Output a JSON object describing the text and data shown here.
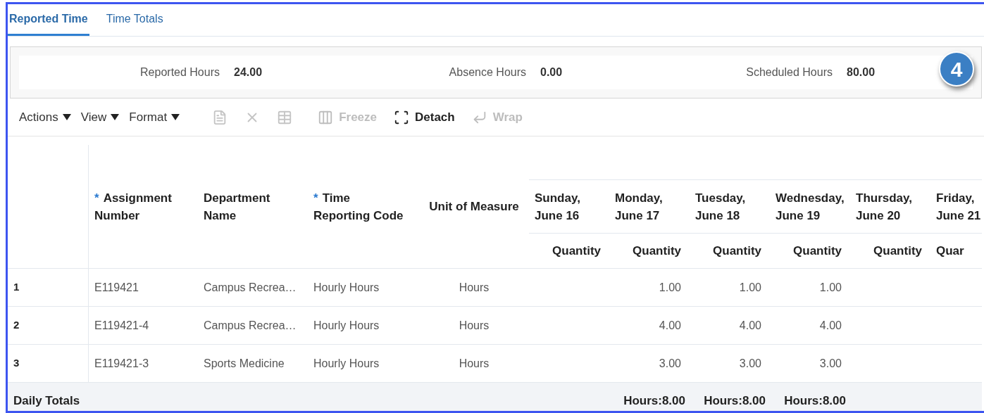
{
  "tabs": [
    {
      "label": "Reported Time",
      "selected": true
    },
    {
      "label": "Time Totals",
      "selected": false
    }
  ],
  "summary": [
    {
      "label": "Reported Hours",
      "value": "24.00"
    },
    {
      "label": "Absence Hours",
      "value": "0.00"
    },
    {
      "label": "Scheduled Hours",
      "value": "80.00"
    }
  ],
  "callout": "4",
  "toolbar": {
    "menus": [
      "Actions",
      "View",
      "Format"
    ],
    "icon_buttons": [
      {
        "kind": "document",
        "disabled": true
      },
      {
        "kind": "delete",
        "disabled": true
      },
      {
        "kind": "grid",
        "disabled": true
      }
    ],
    "buttons": [
      {
        "kind": "freeze",
        "label": "Freeze",
        "disabled": true
      },
      {
        "kind": "detach",
        "label": "Detach",
        "disabled": false
      },
      {
        "kind": "wrap",
        "label": "Wrap",
        "disabled": true
      }
    ]
  },
  "table": {
    "columns": [
      {
        "label": [
          "Assignment",
          "Number"
        ],
        "required_mark": "*"
      },
      {
        "label": [
          "Department",
          "Name"
        ]
      },
      {
        "label": [
          "Time",
          "Reporting Code"
        ],
        "required_mark": "*"
      },
      {
        "label": [
          "Unit of Measure"
        ]
      }
    ],
    "days": [
      {
        "label": [
          "Sunday,",
          "June 16"
        ],
        "sub": "Quantity"
      },
      {
        "label": [
          "Monday,",
          "June 17"
        ],
        "sub": "Quantity",
        "quantities": [
          "1.00",
          "4.00",
          "3.00"
        ],
        "total": "Hours:8.00"
      },
      {
        "label": [
          "Tuesday,",
          "June 18"
        ],
        "sub": "Quantity",
        "quantities": [
          "1.00",
          "4.00",
          "3.00"
        ],
        "total": "Hours:8.00"
      },
      {
        "label": [
          "Wednesday,",
          "June 19"
        ],
        "sub": "Quantity",
        "quantities": [
          "1.00",
          "4.00",
          "3.00"
        ],
        "total": "Hours:8.00"
      },
      {
        "label": [
          "Thursday,",
          "June 20"
        ],
        "sub": "Quantity"
      },
      {
        "label": [
          "Friday,",
          "June 21"
        ],
        "sub": "Quar"
      }
    ],
    "rows": [
      {
        "number": "1",
        "assignment": "E119421",
        "department": "Campus Recrea…",
        "code": "Hourly Hours",
        "unit": "Hours"
      },
      {
        "number": "2",
        "assignment": "E119421-4",
        "department": "Campus Recrea…",
        "code": "Hourly Hours",
        "unit": "Hours"
      },
      {
        "number": "3",
        "assignment": "E119421-3",
        "department": "Sports Medicine",
        "code": "Hourly Hours",
        "unit": "Hours"
      }
    ],
    "totals": {
      "label": "Daily Totals"
    }
  }
}
